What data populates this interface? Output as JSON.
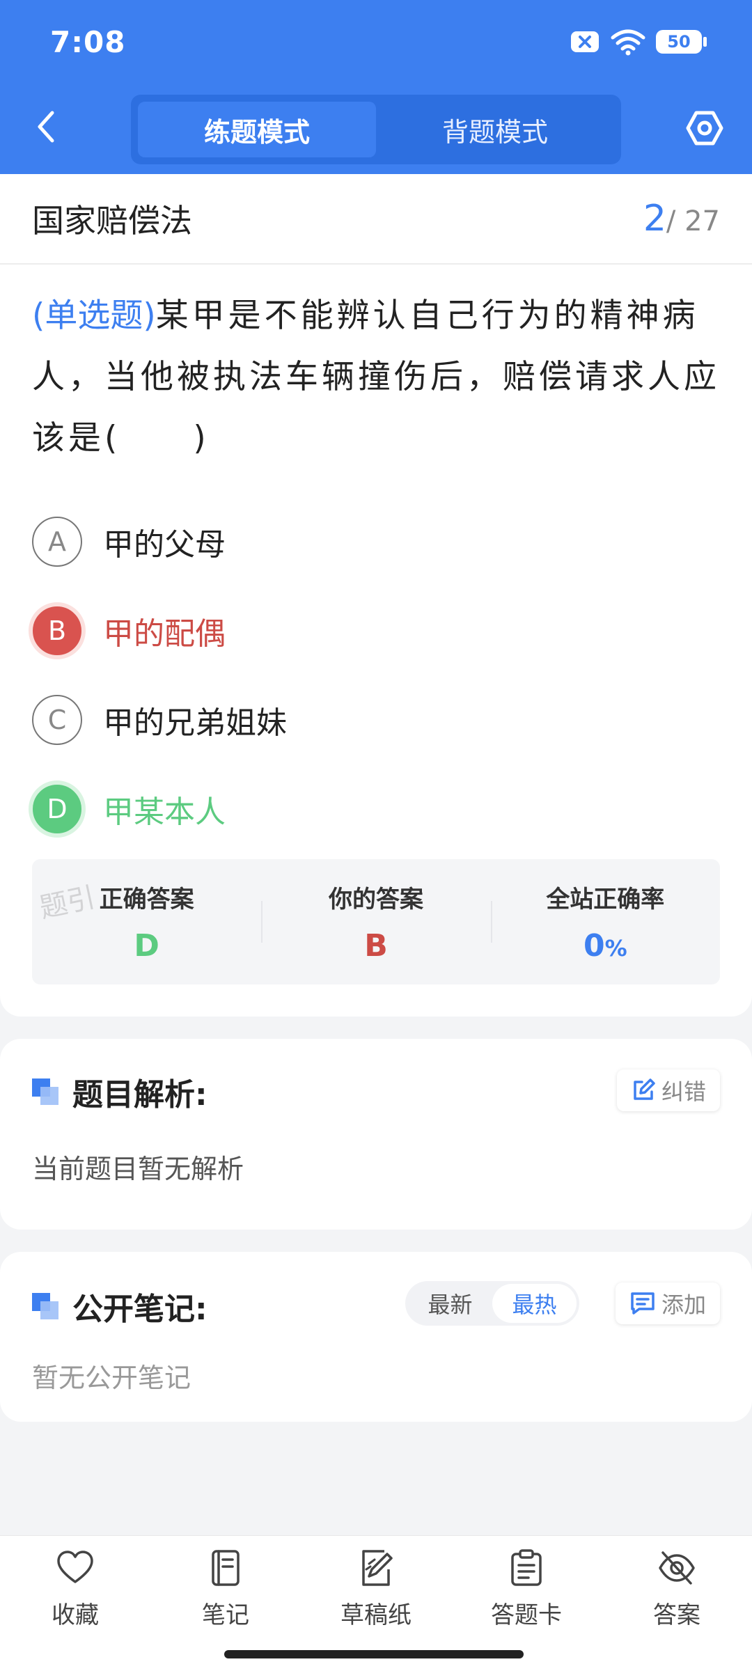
{
  "status_bar": {
    "time": "7:08",
    "battery": "50"
  },
  "nav": {
    "tabs": [
      {
        "label": "练题模式",
        "active": true
      },
      {
        "label": "背题模式",
        "active": false
      }
    ]
  },
  "subject": {
    "title": "国家赔偿法",
    "current": "2",
    "total": "/ 27"
  },
  "question": {
    "type": "(单选题)",
    "text": "某甲是不能辨认自己行为的精神病人，当他被执法车辆撞伤后，赔偿请求人应该是(　　)"
  },
  "options": [
    {
      "letter": "A",
      "text": "甲的父母",
      "state": "normal"
    },
    {
      "letter": "B",
      "text": "甲的配偶",
      "state": "wrong"
    },
    {
      "letter": "C",
      "text": "甲的兄弟姐妹",
      "state": "normal"
    },
    {
      "letter": "D",
      "text": "甲某本人",
      "state": "correct"
    }
  ],
  "answer_box": {
    "watermark": "题引",
    "correct_label": "正确答案",
    "correct_value": "D",
    "yours_label": "你的答案",
    "yours_value": "B",
    "rate_label": "全站正确率",
    "rate_value": "0",
    "rate_unit": "%"
  },
  "analysis": {
    "title": "题目解析:",
    "button": "纠错",
    "body": "当前题目暂无解析"
  },
  "notes": {
    "title": "公开笔记:",
    "sort_latest": "最新",
    "sort_hot": "最热",
    "button": "添加",
    "body": "暂无公开笔记"
  },
  "bottom_tabs": [
    {
      "label": "收藏",
      "icon": "heart-icon"
    },
    {
      "label": "笔记",
      "icon": "notebook-icon"
    },
    {
      "label": "草稿纸",
      "icon": "draft-icon"
    },
    {
      "label": "答题卡",
      "icon": "clipboard-icon"
    },
    {
      "label": "答案",
      "icon": "eye-off-icon"
    }
  ],
  "colors": {
    "primary": "#3d7ff0",
    "correct": "#5ccb80",
    "wrong": "#cc4b45"
  }
}
